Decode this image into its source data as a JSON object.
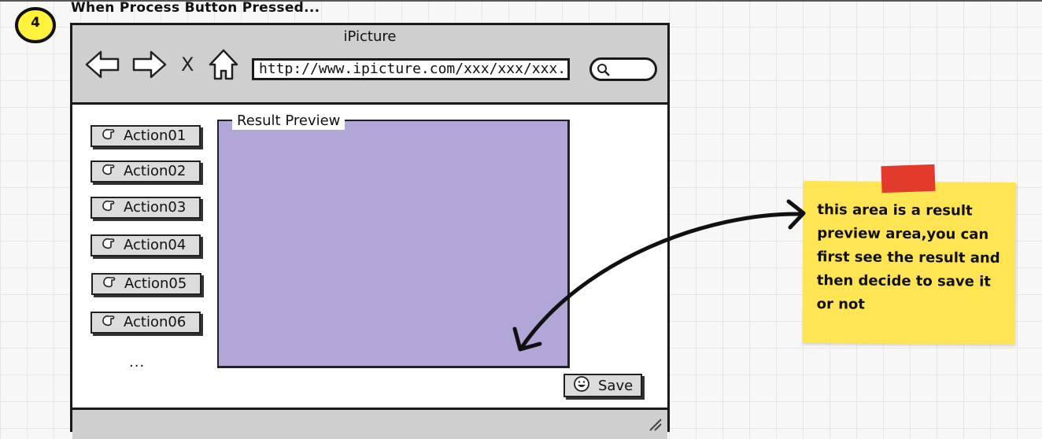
{
  "scene": {
    "step_number": "4",
    "title": "When Process Button Pressed..."
  },
  "browser": {
    "title": "iPicture",
    "nav": {
      "back_icon": "arrow-left-icon",
      "forward_icon": "arrow-right-icon",
      "stop_label": "X",
      "home_icon": "home-icon"
    },
    "url": "http://www.ipicture.com/xxx/xxx/xxx...",
    "search": {
      "value": "",
      "icon": "search-icon"
    }
  },
  "actions": [
    {
      "label": "Action01",
      "icon": "hand-icon"
    },
    {
      "label": "Action02",
      "icon": "hand-icon"
    },
    {
      "label": "Action03",
      "icon": "hand-icon"
    },
    {
      "label": "Action04",
      "icon": "hand-icon"
    },
    {
      "label": "Action05",
      "icon": "hand-icon"
    },
    {
      "label": "Action06",
      "icon": "hand-icon"
    }
  ],
  "actions_more": "...",
  "preview": {
    "legend": "Result Preview",
    "fill_color": "#b2a6d6"
  },
  "save_button": {
    "label": "Save",
    "icon": "smiley-icon"
  },
  "annotation": {
    "text": "this area is a result preview area,you can first see the result and then decide to save it or not",
    "note_color": "#ffe454",
    "tape_color": "#e23a2b"
  }
}
